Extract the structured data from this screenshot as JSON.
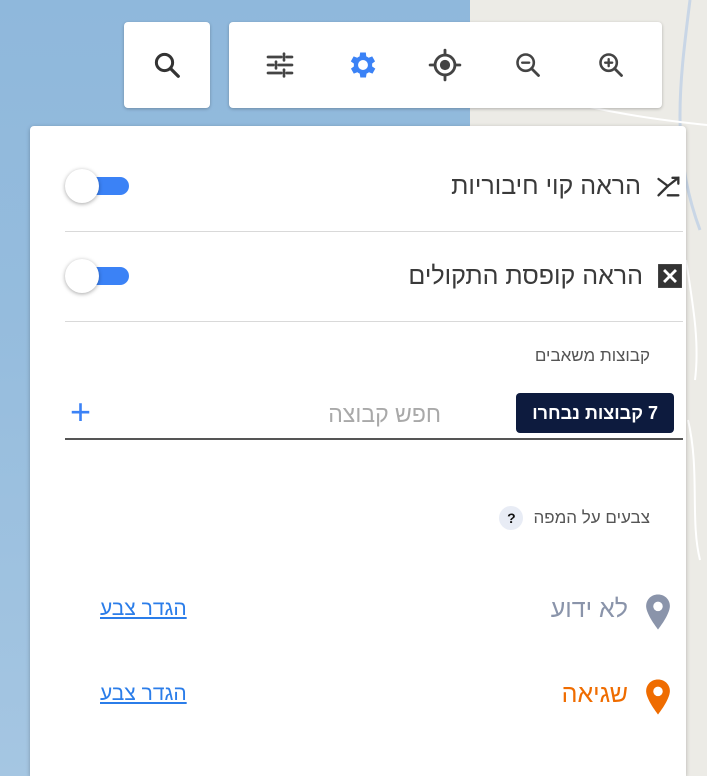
{
  "toolbar": {
    "search_icon": "search-icon",
    "icons": [
      "sliders-icon",
      "gear-icon",
      "locate-icon",
      "zoom-out-icon",
      "zoom-in-icon"
    ],
    "accent": "#3b82f6"
  },
  "panel": {
    "toggles": [
      {
        "label": "הראה קוי חיבוריות",
        "icon": "connection-lines-icon",
        "on": true
      },
      {
        "label": "הראה קופסת התקולים",
        "icon": "close-box-icon",
        "on": true
      }
    ],
    "groups": {
      "title": "קבוצות משאבים",
      "selected_chip": "7 קבוצות נבחרו",
      "search_placeholder": "חפש קבוצה",
      "add_label": "+"
    },
    "colors": {
      "title": "צבעים על המפה",
      "help": "?",
      "items": [
        {
          "name": "לא ידוע",
          "color": "#8a94aa",
          "link": "הגדר צבע"
        },
        {
          "name": "שגיאה",
          "color": "#ef6c00",
          "link": "הגדר צבע"
        }
      ]
    }
  }
}
